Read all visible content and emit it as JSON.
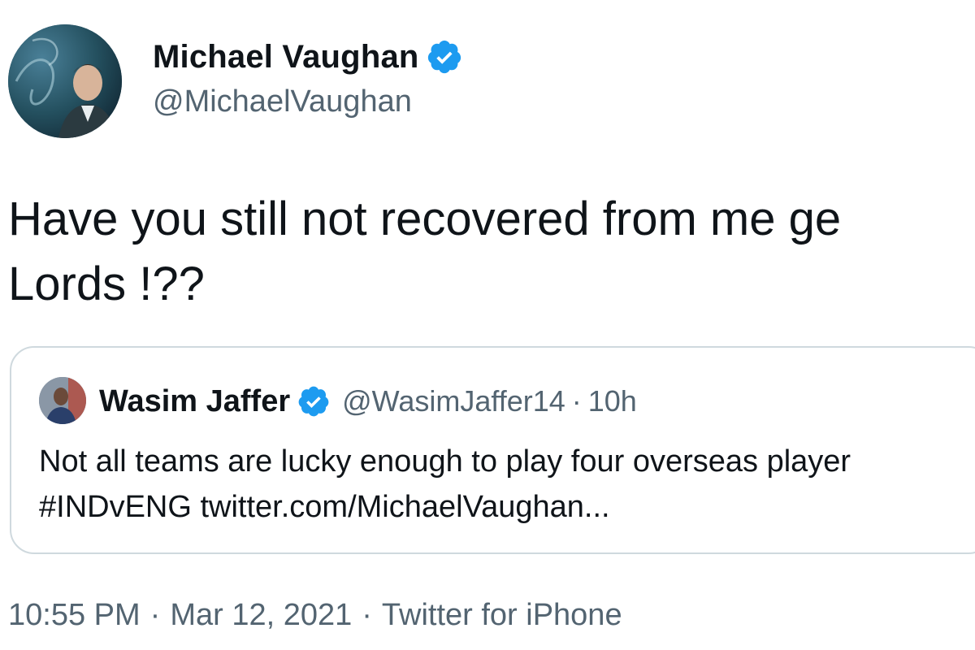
{
  "author": {
    "name": "Michael Vaughan",
    "handle": "@MichaelVaughan",
    "verified": true,
    "avatar_icon": "profile-photo"
  },
  "tweet": {
    "text_lines": [
      "Have you still not recovered from me ge",
      "Lords !??"
    ]
  },
  "quoted_tweet": {
    "name": "Wasim Jaffer",
    "handle": "@WasimJaffer14",
    "separator": "·",
    "time": "10h",
    "verified": true,
    "text_lines": [
      "Not all teams are lucky enough to play four overseas player",
      "#INDvENG twitter.com/MichaelVaughan..."
    ]
  },
  "meta": {
    "time": "10:55 PM",
    "separator": "·",
    "date": "Mar 12, 2021",
    "source": "Twitter for iPhone"
  },
  "colors": {
    "text": "#0f1419",
    "secondary": "#536471",
    "verified_blue": "#1d9bf0",
    "border": "#cfd9de"
  }
}
